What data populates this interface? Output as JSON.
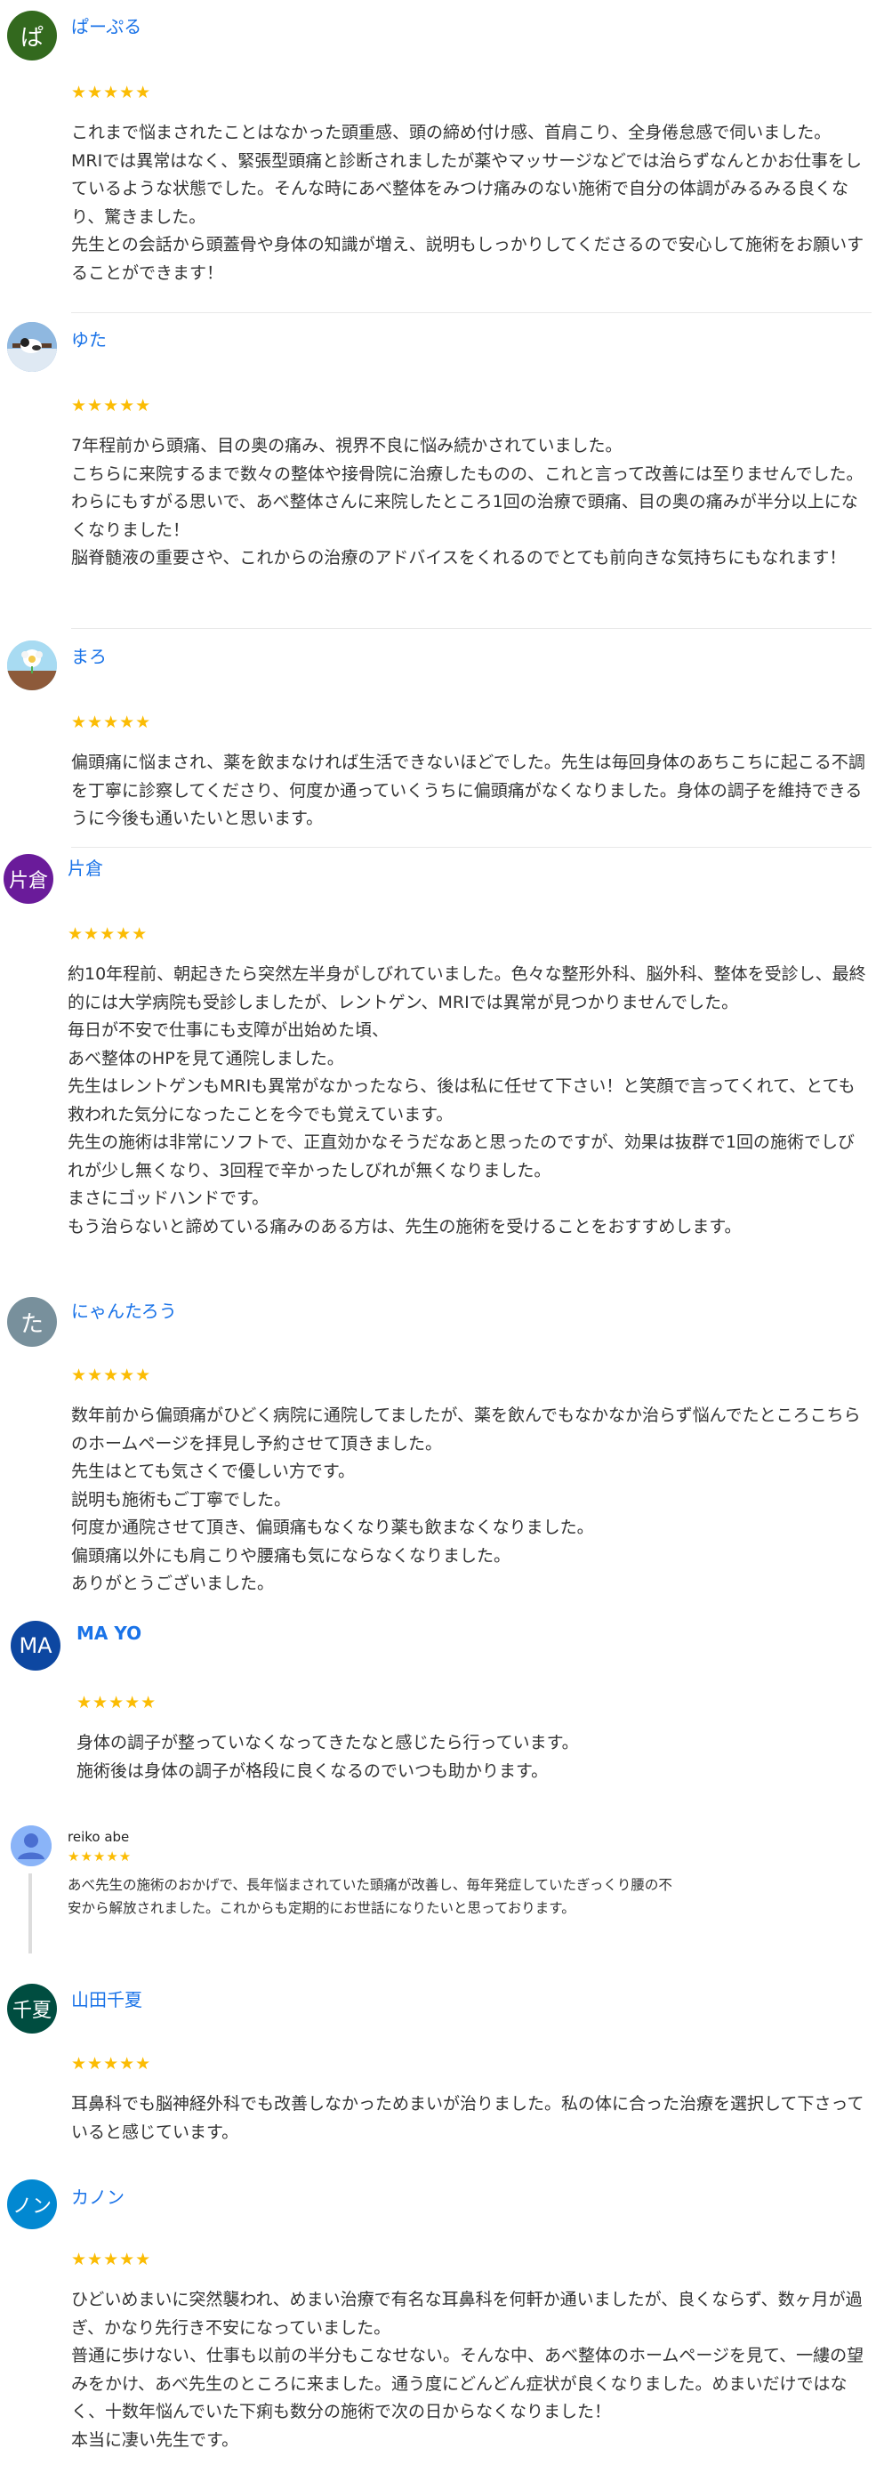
{
  "reviews": [
    {
      "name": "ぱーぷる",
      "avatar": {
        "type": "letter",
        "text": "ぱ",
        "bg": "#33691e"
      },
      "rating": "★★★★★",
      "lines": [
        "これまで悩まされたことはなかった頭重感、頭の締め付け感、首肩こり、全身倦怠感で伺いました。",
        "MRIでは異常はなく、緊張型頭痛と診断されましたが薬やマッサージなどでは治らずなんとかお仕事をしているような状態でした。そんな時にあべ整体をみつけ痛みのない施術で自分の体調がみるみる良くなり、驚きました。",
        "先生との会話から頭蓋骨や身体の知識が増え、説明もしっかりしてくださるので安心して施術をお願いすることができます！"
      ]
    },
    {
      "name": "ゆた",
      "avatar": {
        "type": "photo",
        "icon": "cat-photo-icon",
        "bg": "#7fa9d6"
      },
      "rating": "★★★★★",
      "lines": [
        "7年程前から頭痛、目の奥の痛み、視界不良に悩み続かされていました。",
        "こちらに来院するまで数々の整体や接骨院に治療したものの、これと言って改善には至りませんでした。",
        "わらにもすがる思いで、あべ整体さんに来院したところ1回の治療で頭痛、目の奥の痛みが半分以上になくなりました！",
        "脳脊髄液の重要さや、これからの治療のアドバイスをくれるのでとても前向きな気持ちにもなれます！"
      ]
    },
    {
      "name": "まろ",
      "avatar": {
        "type": "photo",
        "icon": "flower-photo-icon",
        "bg": "#9fd3ee"
      },
      "rating": "★★★★★",
      "lines": [
        "偏頭痛に悩まされ、薬を飲まなければ生活できないほどでした。先生は毎回身体のあちこちに起こる不調を丁寧に診察してくださり、何度か通っていくうちに偏頭痛がなくなりました。身体の調子を維持できるうに今後も通いたいと思います。"
      ]
    },
    {
      "name": "片倉",
      "avatar": {
        "type": "letter",
        "text": "片倉",
        "bg": "#6a1b9a"
      },
      "rating": "★★★★★",
      "lines": [
        "約10年程前、朝起きたら突然左半身がしびれていました。色々な整形外科、脳外科、整体を受診し、最終的には大学病院も受診しましたが、レントゲン、MRIでは異常が見つかりませんでした。",
        "毎日が不安で仕事にも支障が出始めた頃、",
        "あべ整体のHPを見て通院しました。",
        "先生はレントゲンもMRIも異常がなかったなら、後は私に任せて下さい！と笑顔で言ってくれて、とても救われた気分になったことを今でも覚えています。",
        "先生の施術は非常にソフトで、正直効かなそうだなあと思ったのですが、効果は抜群で1回の施術でしびれが少し無くなり、3回程で辛かったしびれが無くなりました。",
        "まさにゴッドハンドです。",
        "もう治らないと諦めている痛みのある方は、先生の施術を受けることをおすすめします。"
      ]
    },
    {
      "name": "にゃんたろう",
      "avatar": {
        "type": "letter",
        "text": "た",
        "bg": "#78909c"
      },
      "rating": "★★★★★",
      "lines": [
        "数年前から偏頭痛がひどく病院に通院してましたが、薬を飲んでもなかなか治らず悩んでたところこちらのホームページを拝見し予約させて頂きました。",
        "先生はとても気さくで優しい方です。",
        "説明も施術もご丁寧でした。",
        "何度か通院させて頂き、偏頭痛もなくなり薬も飲まなくなりました。",
        "偏頭痛以外にも肩こりや腰痛も気にならなくなりました。",
        "ありがとうございました。"
      ]
    },
    {
      "name": "MA YO",
      "avatar": {
        "type": "letter",
        "text": "MA",
        "bg": "#0d47a1"
      },
      "rating": "★★★★★",
      "lines": [
        "身体の調子が整っていなくなってきたなと感じたら行っています。",
        "施術後は身体の調子が格段に良くなるのでいつも助かります。"
      ]
    },
    {
      "name": "reiko abe",
      "avatar": {
        "type": "default",
        "icon": "default-user-icon",
        "bg": "#8ab4f8"
      },
      "rating": "★★★★★",
      "lines": [
        "あべ先生の施術のおかげで、長年悩まされていた頭痛が改善し、毎年発症していたぎっくり腰の不安から解放されました。これからも定期的にお世話になりたいと思っております。"
      ]
    },
    {
      "name": "山田千夏",
      "avatar": {
        "type": "letter",
        "text": "千夏",
        "bg": "#004d40"
      },
      "rating": "★★★★★",
      "lines": [
        "耳鼻科でも脳神経外科でも改善しなかっためまいが治りました。私の体に合った治療を選択して下さっていると感じています。"
      ]
    },
    {
      "name": "カノン",
      "avatar": {
        "type": "letter",
        "text": "ノン",
        "bg": "#0288d1"
      },
      "rating": "★★★★★",
      "lines": [
        "ひどいめまいに突然襲われ、めまい治療で有名な耳鼻科を何軒か通いましたが、良くならず、数ヶ月が過ぎ、かなり先行き不安になっていました。",
        "普通に歩けない、仕事も以前の半分もこなせない。そんな中、あべ整体のホームページを見て、一縷の望みをかけ、あべ先生のところに来ました。通う度にどんどん症状が良くなりました。めまいだけではなく、十数年悩んでいた下痢も数分の施術で次の日からなくなりました！",
        "本当に凄い先生です。"
      ]
    }
  ]
}
